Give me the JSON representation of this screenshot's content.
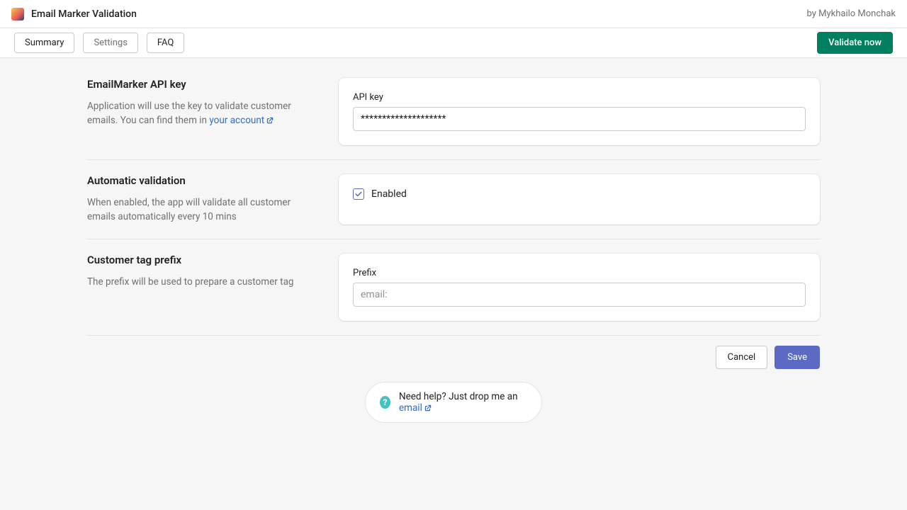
{
  "header": {
    "app_title": "Email Marker Validation",
    "byline": "by Mykhailo Monchak"
  },
  "tabs": {
    "summary": "Summary",
    "settings": "Settings",
    "faq": "FAQ",
    "validate_now": "Validate now"
  },
  "sections": {
    "api_key": {
      "title": "EmailMarker API key",
      "desc_pre": "Application will use the key to validate customer emails. You can find them in ",
      "desc_link": "your account",
      "field_label": "API key",
      "value": "********************"
    },
    "auto": {
      "title": "Automatic validation",
      "desc": "When enabled, the app will validate all customer emails automatically every 10 mins",
      "checkbox_label": "Enabled",
      "checked": true
    },
    "prefix": {
      "title": "Customer tag prefix",
      "desc": "The prefix will be used to prepare a customer tag",
      "field_label": "Prefix",
      "placeholder": "email:"
    }
  },
  "actions": {
    "cancel": "Cancel",
    "save": "Save"
  },
  "help": {
    "text_pre": "Need help? Just drop me an ",
    "link": "email"
  }
}
